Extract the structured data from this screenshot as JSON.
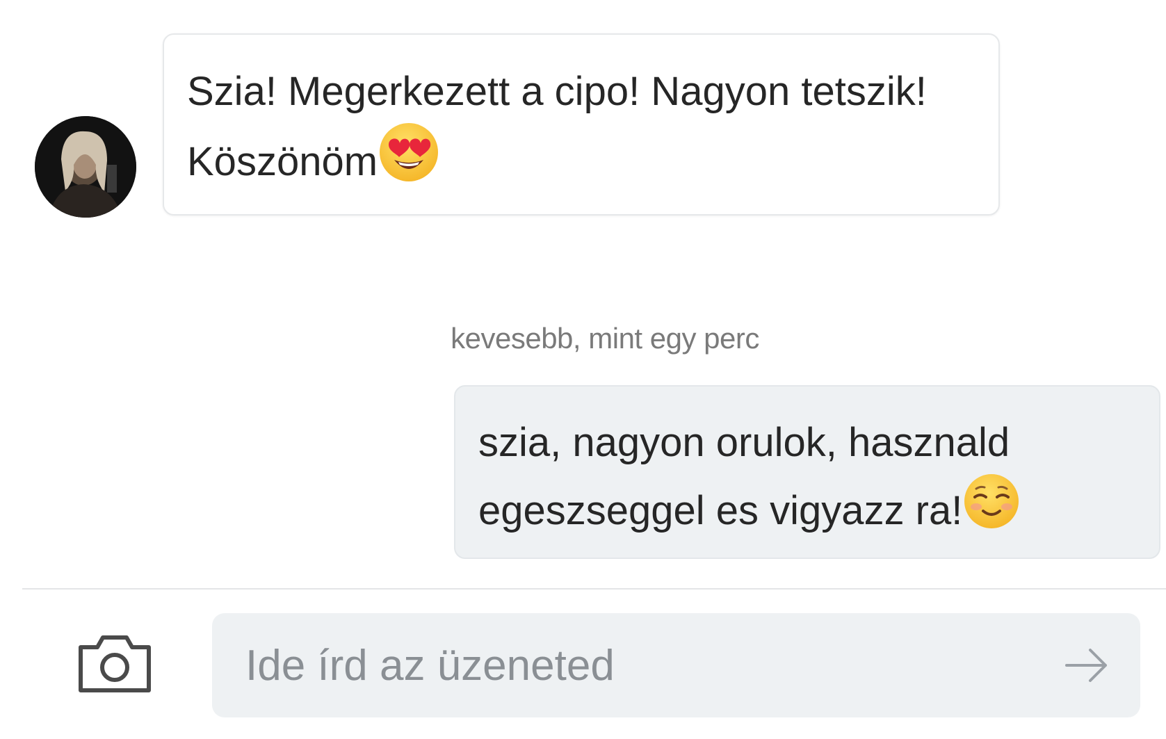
{
  "conversation": {
    "incoming": {
      "text": "Szia! Megerkezett a cipo! Nagyon tetszik! Köszönöm",
      "emoji": "heart-eyes-emoji"
    },
    "timestamp": "kevesebb, mint egy perc",
    "outgoing": {
      "text": "szia, nagyon orulok, hasznald egeszseggel es vigyazz ra!",
      "emoji": "smiling-face-emoji"
    }
  },
  "composer": {
    "placeholder": "Ide írd az üzeneted",
    "camera_icon": "camera-icon",
    "send_icon": "arrow-right-icon"
  },
  "colors": {
    "incoming_bubble": "#ffffff",
    "outgoing_bubble": "#eef1f3",
    "input_background": "#eef1f3",
    "timestamp_text": "#7a7a7a"
  }
}
